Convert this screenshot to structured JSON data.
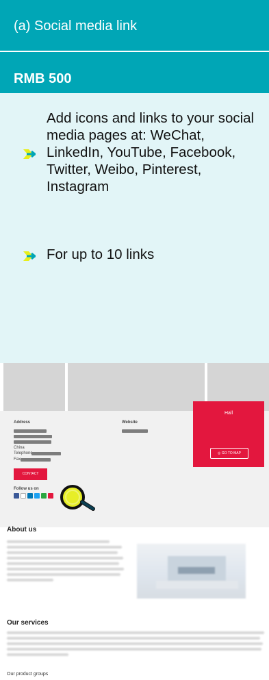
{
  "header": {
    "title": "(a) Social media link"
  },
  "price": {
    "label": "RMB 500"
  },
  "features": [
    {
      "text": "Add icons and links to your social media pages at: WeChat, LinkedIn, YouTube, Facebook, Twitter, Weibo, Pinterest, Instagram"
    },
    {
      "text": "For up to 10 links"
    }
  ],
  "preview": {
    "address_label": "Address",
    "website_label": "Website",
    "country": "China",
    "telephone_label": "Telephone",
    "fax_label": "Fax",
    "contact_button": "CONTACT",
    "follow_label": "Follow us on",
    "hall_title": "Hall",
    "map_button": "GO TO MAP",
    "about_title": "About us",
    "services_title": "Our services",
    "product_groups": "Our product groups"
  },
  "colors": {
    "accent": "#00a6b6",
    "panel": "#e2f5f7",
    "red": "#e3173e",
    "magnifier": "#e7ee27"
  },
  "icons": {
    "bullet": "arrow-right-bullet-icon",
    "magnifier": "magnifier-icon",
    "map_pin": "map-pin-icon"
  }
}
